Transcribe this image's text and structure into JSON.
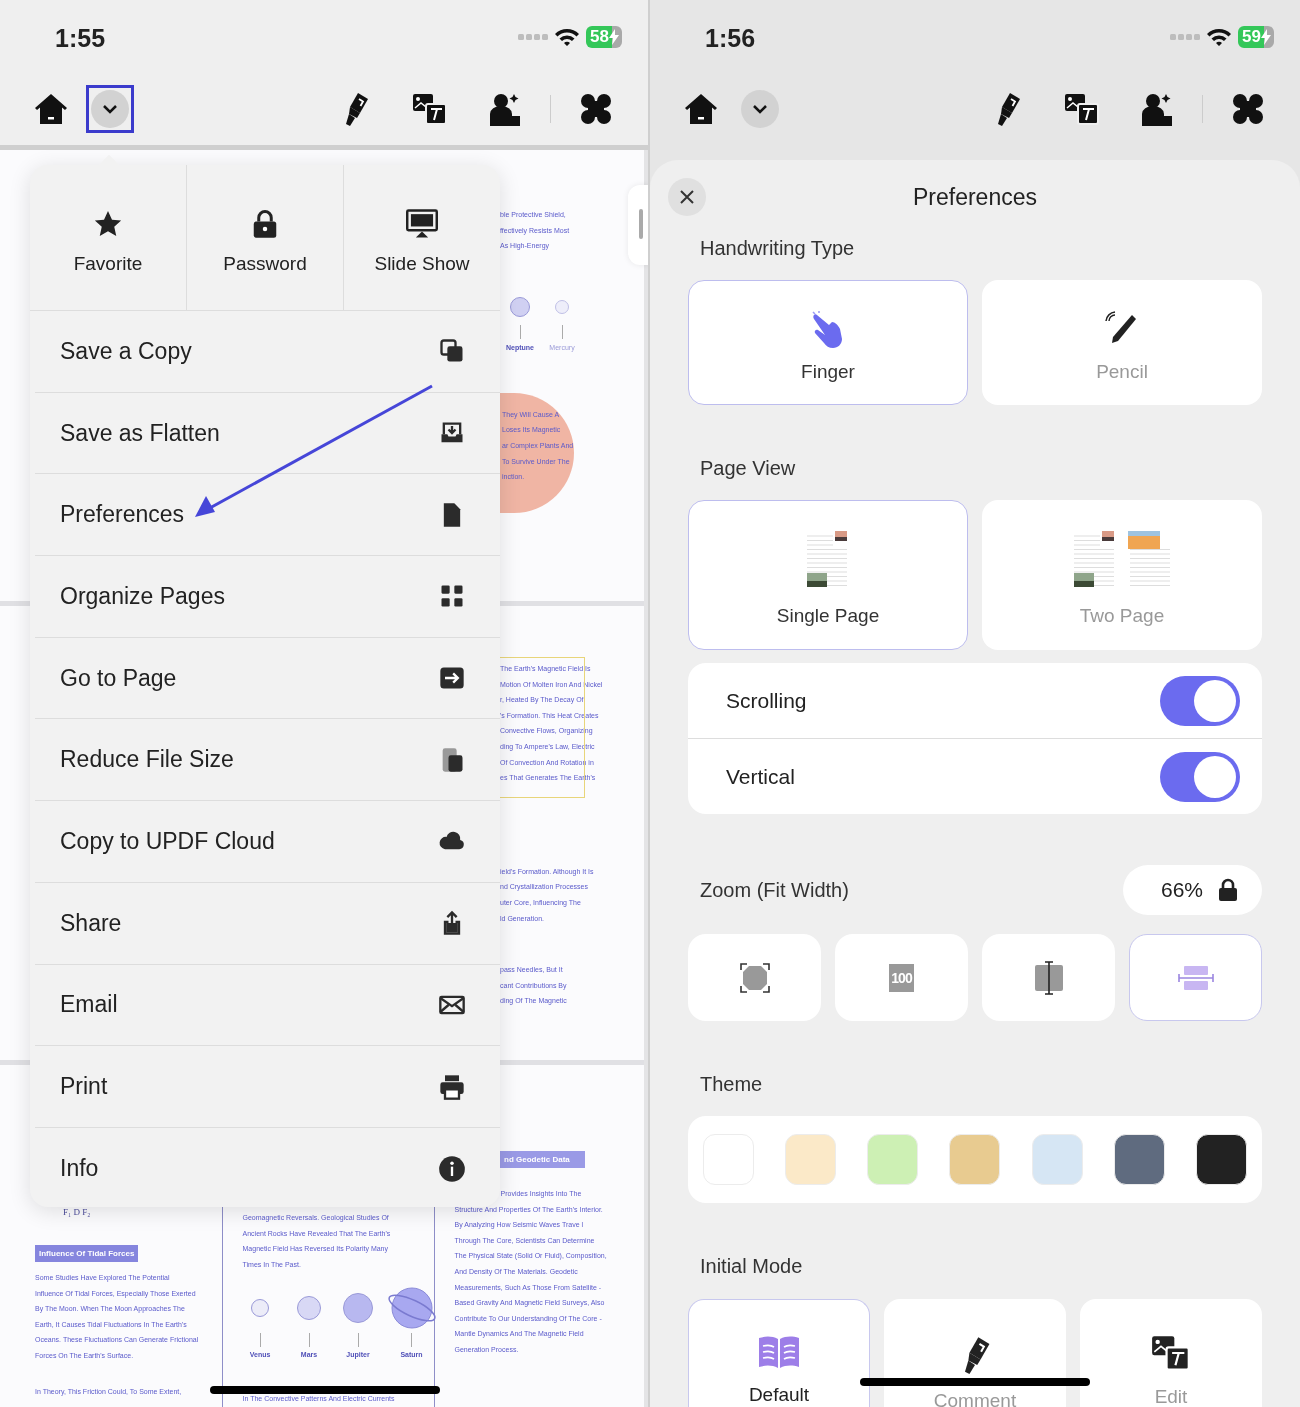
{
  "left_screen": {
    "status_bar": {
      "time": "1:55",
      "battery": "58"
    },
    "toolbar": {
      "dropdown_highlighted": true
    },
    "menu": {
      "quick_actions": [
        {
          "label": "Favorite"
        },
        {
          "label": "Password"
        },
        {
          "label": "Slide Show"
        }
      ],
      "items": [
        {
          "label": "Save a Copy"
        },
        {
          "label": "Save as Flatten"
        },
        {
          "label": "Preferences"
        },
        {
          "label": "Organize Pages"
        },
        {
          "label": "Go to Page"
        },
        {
          "label": "Reduce File Size"
        },
        {
          "label": "Copy to UPDF Cloud"
        },
        {
          "label": "Share"
        },
        {
          "label": "Email"
        },
        {
          "label": "Print"
        },
        {
          "label": "Info"
        }
      ]
    },
    "document": {
      "pages": [
        {
          "blocks": [
            {
              "kind": "text",
              "lines": [
                "ble Protective Shield,",
                "ffectively Resists Most",
                "As High-Energy"
              ]
            },
            {
              "kind": "planets",
              "labels": [
                "Neptune",
                "Mercury"
              ]
            },
            {
              "kind": "blob",
              "lines": [
                "They Will Cause A",
                "Loses Its Magnetic",
                "ar Complex Plants And",
                "To Survive Under The",
                "inction."
              ]
            }
          ]
        },
        {
          "blocks": [
            {
              "kind": "boxed",
              "lines": [
                "The Earth's Magnetic Field Is",
                "Motion Of Molten Iron And Nickel",
                "r, Heated By The Decay Of",
                "'s Formation. This Heat Creates",
                "Convective Flows, Organizing",
                "ding To Ampere's Law, Electric",
                "Of Convection And Rotation in",
                "es That Generates The Earth's"
              ]
            },
            {
              "kind": "text",
              "lines": [
                "ield's Formation. Although It Is",
                "nd Crystallization Processes",
                "uter Core, Influencing The",
                "ld Generation."
              ]
            },
            {
              "kind": "text",
              "lines": [
                "pass Needles, But It",
                "cant Contributions By",
                "ding Of The Magnetic"
              ]
            }
          ]
        },
        {
          "blocks": [
            {
              "kind": "heading",
              "text": "nd Geodetic Data"
            }
          ],
          "columns": {
            "left": {
              "formula": "F₁  D  F₂",
              "heading": "Influence Of Tidal Forces",
              "paragraphs": [
                [
                  "Some Studies Have Explored The Potential",
                  "Influence Of Tidal Forces, Especially Those Exerted",
                  "By The Moon. When The Moon Approaches The",
                  "Earth, It Causes Tidal Fluctuations In The Earth's",
                  "Oceans. These Fluctuations Can Generate Frictional",
                  "Forces On The Earth's Surface."
                ],
                [
                  "In Theory, This Friction Could, To Some Extent,"
                ]
              ]
            },
            "middle": {
              "lines": [
                "Geomagnetic Reversals. Geological Studies Of",
                "Ancient Rocks Have Revealed That The Earth's",
                "Magnetic Field Has Reversed Its Polarity Many",
                "Times In The Past."
              ],
              "planets": [
                "Venus",
                "Mars",
                "Jupiter",
                "Saturn"
              ],
              "lines_after": [
                "In The Convective Patterns And Electric Currents"
              ]
            },
            "right": {
              "lines": [
                "Provides Insights Into The",
                "Structure And Properties Of The Earth's Interior.",
                "By Analyzing How Seismic Waves Trave l",
                "Through The Core, Scientists Can Determine",
                "The Physical State (Solid Or Fluid), Composition,",
                "And Density Of The Materials. Geodetic",
                "Measurements, Such As Those From Satellite -",
                "Based Gravity And Magnetic Field Surveys, Also",
                "Contribute To Our Understanding Of The Core -",
                "Mantle Dynamics And The Magnetic Field",
                "Generation Process."
              ]
            }
          }
        }
      ]
    }
  },
  "right_screen": {
    "status_bar": {
      "time": "1:56",
      "battery": "59"
    },
    "toolbar": {
      "dropdown_highlighted": false
    },
    "preferences": {
      "title": "Preferences",
      "handwriting_type": {
        "label": "Handwriting Type",
        "options": [
          {
            "label": "Finger",
            "selected": true
          },
          {
            "label": "Pencil",
            "selected": false
          }
        ]
      },
      "page_view": {
        "label": "Page View",
        "options": [
          {
            "label": "Single Page",
            "selected": true
          },
          {
            "label": "Two Page",
            "selected": false
          }
        ]
      },
      "toggles": [
        {
          "label": "Scrolling",
          "on": true
        },
        {
          "label": "Vertical",
          "on": true
        }
      ],
      "zoom": {
        "label": "Zoom (Fit Width)",
        "value": "66%",
        "options": [
          {
            "selected": false
          },
          {
            "selected": false,
            "icon_text": "100"
          },
          {
            "selected": false
          },
          {
            "selected": true
          }
        ]
      },
      "theme": {
        "label": "Theme",
        "swatches": [
          {
            "color": "#ffffff",
            "selected": false
          },
          {
            "color": "#fbe9c8",
            "selected": false
          },
          {
            "color": "#cdf0b4",
            "selected": false
          },
          {
            "color": "#e8cb90",
            "selected": false
          },
          {
            "color": "#d6e6f4",
            "selected": false
          },
          {
            "color": "#5f6b7f",
            "selected": false
          },
          {
            "color": "#222222",
            "selected": false
          }
        ]
      },
      "initial_mode": {
        "label": "Initial Mode",
        "options": [
          {
            "label": "Default",
            "selected": true
          },
          {
            "label": "Comment",
            "selected": false
          },
          {
            "label": "Edit",
            "selected": false
          }
        ]
      }
    }
  }
}
